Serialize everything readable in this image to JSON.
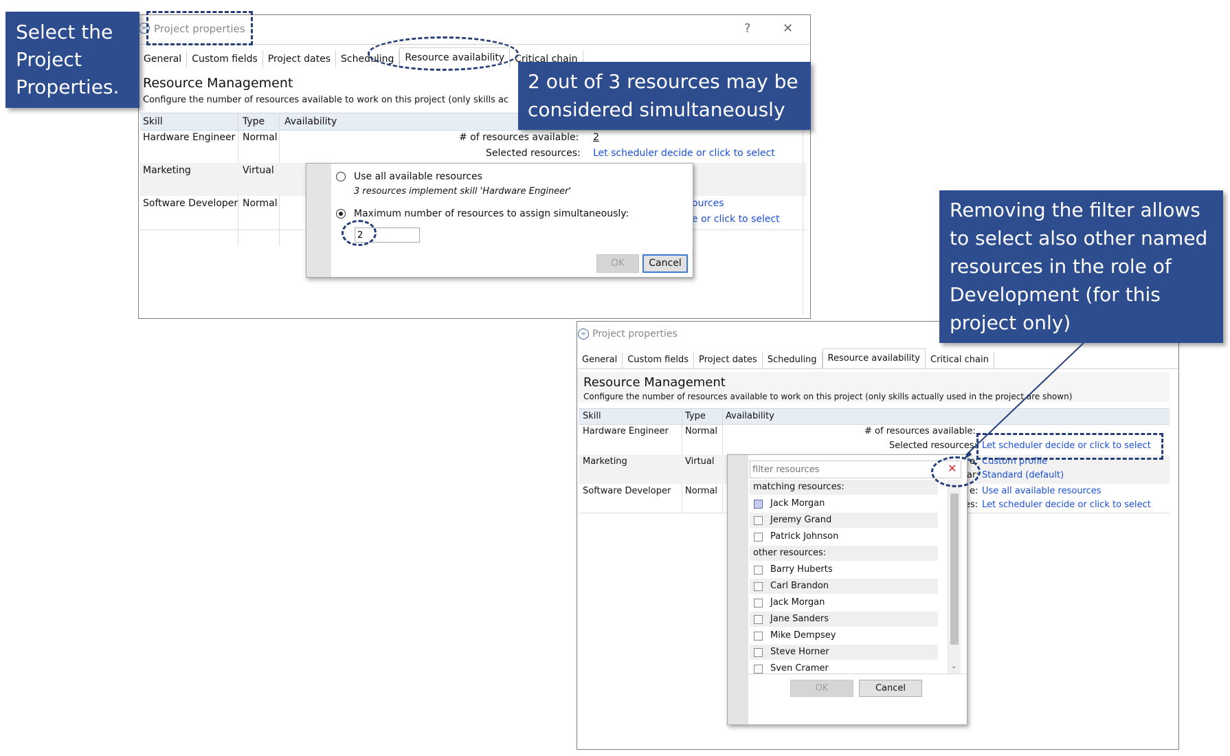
{
  "window1": {
    "title": "Project properties",
    "help_button": "?",
    "close_button": "✕",
    "tabs": [
      "General",
      "Custom fields",
      "Project dates",
      "Scheduling",
      "Resource availability",
      "Critical chain"
    ],
    "section_title": "Resource Management",
    "section_desc": "Configure the number of resources available to work on this project (only skills ac",
    "columns": [
      "Skill",
      "Type",
      "Availability"
    ],
    "rows": [
      {
        "skill": "Hardware Engineer",
        "type": "Normal",
        "avail_label": "# of resources available:",
        "avail_value": "2",
        "sel_label": "Selected resources:",
        "sel_value": "Let scheduler decide or click to select"
      },
      {
        "skill": "Marketing",
        "type": "Virtual"
      },
      {
        "skill": "Software Developer",
        "type": "Normal",
        "avail_value": "ources",
        "sel_value": "e or click to select"
      }
    ],
    "popup": {
      "option1": "Use all available resources",
      "option1_note": "3 resources implement skill 'Hardware Engineer'",
      "option2": "Maximum number of resources to assign simultaneously:",
      "max_value": "2",
      "ok": "OK",
      "cancel": "Cancel"
    }
  },
  "window2": {
    "title": "Project properties",
    "tabs": [
      "General",
      "Custom fields",
      "Project dates",
      "Scheduling",
      "Resource availability",
      "Critical chain"
    ],
    "section_title": "Resource Management",
    "section_desc": "Configure the number of resources available to work on this project (only skills actually used in the project are shown)",
    "columns": [
      "Skill",
      "Type",
      "Availability"
    ],
    "rows": [
      {
        "skill": "Hardware Engineer",
        "type": "Normal",
        "avail_label": "# of resources available:",
        "sel_label": "Selected resources:",
        "sel_value": "Let scheduler decide or click to select"
      },
      {
        "skill": "Marketing",
        "type": "Virtual",
        "l1_label": "e:",
        "l1_value": "Custom profile",
        "l2_label": "ar:",
        "l2_value": "Standard (default)"
      },
      {
        "skill": "Software Developer",
        "type": "Normal",
        "l1_label": "e:",
        "l1_value": "Use all available resources",
        "l2_label": "es:",
        "l2_value": "Let scheduler decide or click to select"
      }
    ],
    "popup": {
      "filter_placeholder": "filter resources",
      "clear_icon": "✕",
      "matching_header": "matching resources:",
      "matching": [
        "Jack Morgan",
        "Jeremy Grand",
        "Patrick Johnson"
      ],
      "other_header": "other resources:",
      "others": [
        "Barry Huberts",
        "Carl Brandon",
        "Jack Morgan",
        "Jane Sanders",
        "Mike Dempsey",
        "Steve Horner",
        "Sven Cramer"
      ],
      "ok": "OK",
      "cancel": "Cancel"
    }
  },
  "callouts": {
    "select_properties": "Select the Project Properties.",
    "two_of_three": "2 out of 3 resources may be considered simultaneously",
    "removing_filter": "Removing the filter allows to select also other named resources in the role of Development (for this project only)"
  },
  "colors": {
    "callout_bg": "#2e4d8f",
    "link": "#1a4fd6",
    "dash": "#243f7a"
  }
}
